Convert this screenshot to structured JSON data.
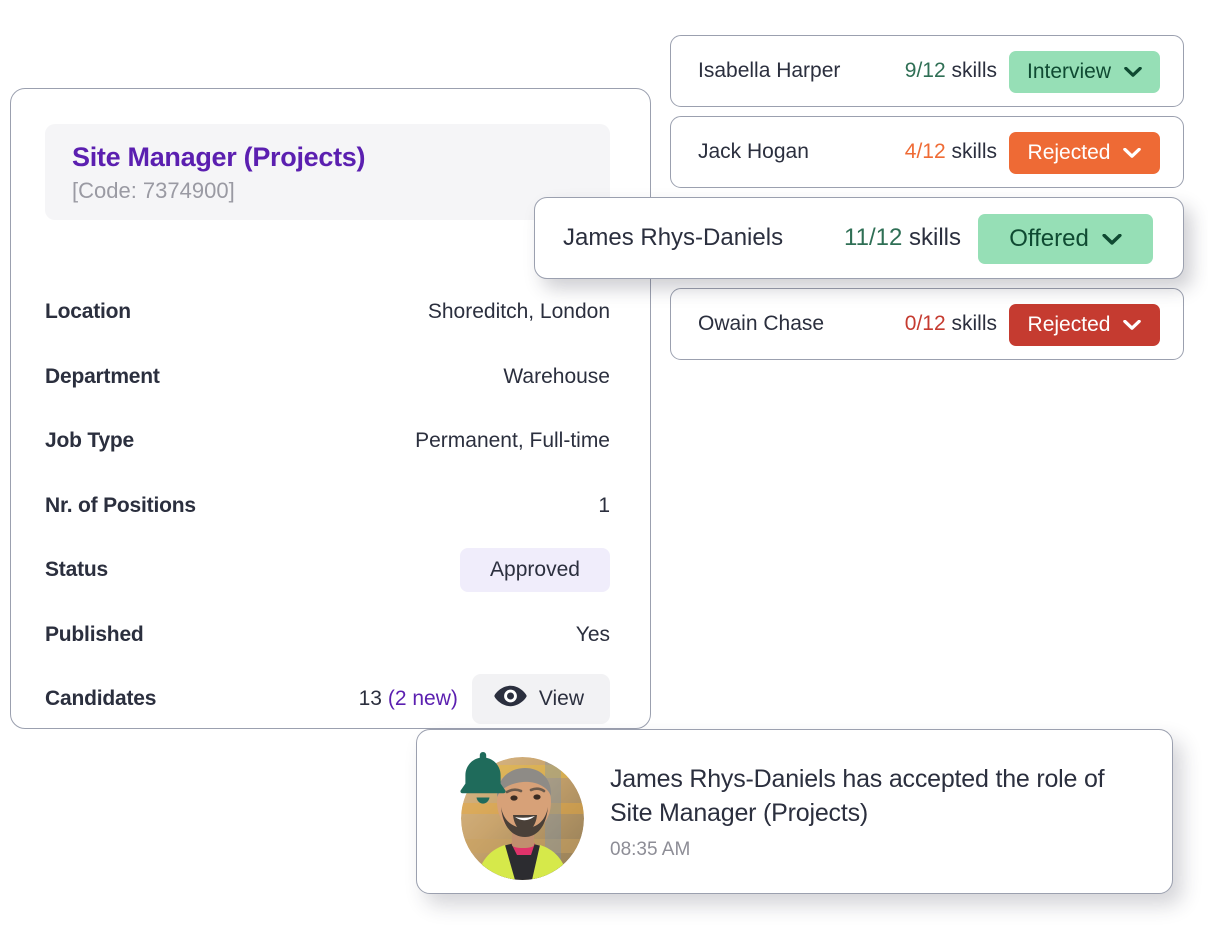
{
  "job": {
    "title": "Site Manager (Projects)",
    "code": "[Code: 7374900]",
    "details": [
      {
        "label": "Location",
        "value": "Shoreditch, London",
        "type": "text"
      },
      {
        "label": "Department",
        "value": "Warehouse",
        "type": "text"
      },
      {
        "label": "Job Type",
        "value": "Permanent, Full-time",
        "type": "text"
      },
      {
        "label": "Nr. of Positions",
        "value": "1",
        "type": "text"
      },
      {
        "label": "Status",
        "value": "Approved",
        "type": "pill"
      },
      {
        "label": "Published",
        "value": "Yes",
        "type": "text"
      },
      {
        "label": "Candidates",
        "value": "13",
        "type": "candidates"
      }
    ],
    "candidates_count": "13",
    "candidates_new": "(2 new)",
    "view_button_label": "View",
    "view_icon": "eye-icon",
    "status_pill_label": "Approved"
  },
  "candidates": [
    {
      "name": "Isabella Harper",
      "skills_fraction": "9/12",
      "skills_suffix": "skills",
      "skills_color": "#2f6f55",
      "status": "Interview",
      "badge_bg": "#96dfb6",
      "badge_fg": "#0f4a32",
      "chevron_icon": "chevron-down-icon",
      "featured": false
    },
    {
      "name": "Jack Hogan",
      "skills_fraction": "4/12",
      "skills_suffix": "skills",
      "skills_color": "#ef6b35",
      "status": "Rejected",
      "badge_bg": "#ee6a35",
      "badge_fg": "#ffffff",
      "chevron_icon": "chevron-down-icon",
      "featured": false
    },
    {
      "name": "James Rhys-Daniels",
      "skills_fraction": "11/12",
      "skills_suffix": "skills",
      "skills_color": "#2f6f55",
      "status": "Offered",
      "badge_bg": "#96dfb6",
      "badge_fg": "#0f4a32",
      "chevron_icon": "chevron-down-icon",
      "featured": true
    },
    {
      "name": "Owain Chase",
      "skills_fraction": "0/12",
      "skills_suffix": "skills",
      "skills_color": "#c53b30",
      "status": "Rejected",
      "badge_bg": "#c53b30",
      "badge_fg": "#ffffff",
      "chevron_icon": "chevron-down-icon",
      "featured": false
    }
  ],
  "notification": {
    "message": "James Rhys-Daniels has accepted the role of Site Manager (Projects)",
    "time": "08:35 AM",
    "bell_icon": "bell-icon",
    "avatar_icon": "avatar-photo"
  },
  "colors": {
    "brand_purple": "#5b1fb0",
    "text_dark": "#2b2f3e",
    "text_muted": "#9a9aa3",
    "card_border": "#9ba0af",
    "pill_lavender": "#f0edfb",
    "green_badge": "#96dfb6",
    "orange_badge": "#ee6a35",
    "red_badge": "#c53b30",
    "teal_bell": "#1f6b5b"
  }
}
